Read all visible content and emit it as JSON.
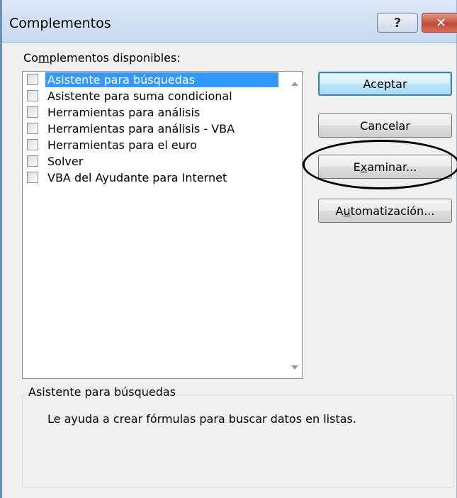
{
  "window": {
    "title": "Complementos",
    "help_label": "?",
    "close_label": "✕"
  },
  "available": {
    "label_pre": "Co",
    "label_ul": "m",
    "label_post": "plementos disponibles:",
    "items": [
      {
        "label": "Asistente para búsquedas",
        "checked": false,
        "selected": true
      },
      {
        "label": "Asistente para suma condicional",
        "checked": false,
        "selected": false
      },
      {
        "label": "Herramientas para análisis",
        "checked": false,
        "selected": false
      },
      {
        "label": "Herramientas para análisis - VBA",
        "checked": false,
        "selected": false
      },
      {
        "label": "Herramientas para el euro",
        "checked": false,
        "selected": false
      },
      {
        "label": "Solver",
        "checked": false,
        "selected": false
      },
      {
        "label": "VBA del Ayudante para Internet",
        "checked": false,
        "selected": false
      }
    ]
  },
  "buttons": {
    "ok": "Aceptar",
    "cancel": "Cancelar",
    "browse_pre": "E",
    "browse_ul": "x",
    "browse_post": "aminar...",
    "automation_pre": "A",
    "automation_ul": "u",
    "automation_post": "tomatización..."
  },
  "description": {
    "title": "Asistente para búsquedas",
    "text": "Le ayuda a crear fórmulas para buscar datos en listas."
  },
  "colors": {
    "selection": "#3399ff",
    "annotation_ellipse": "#000000"
  }
}
